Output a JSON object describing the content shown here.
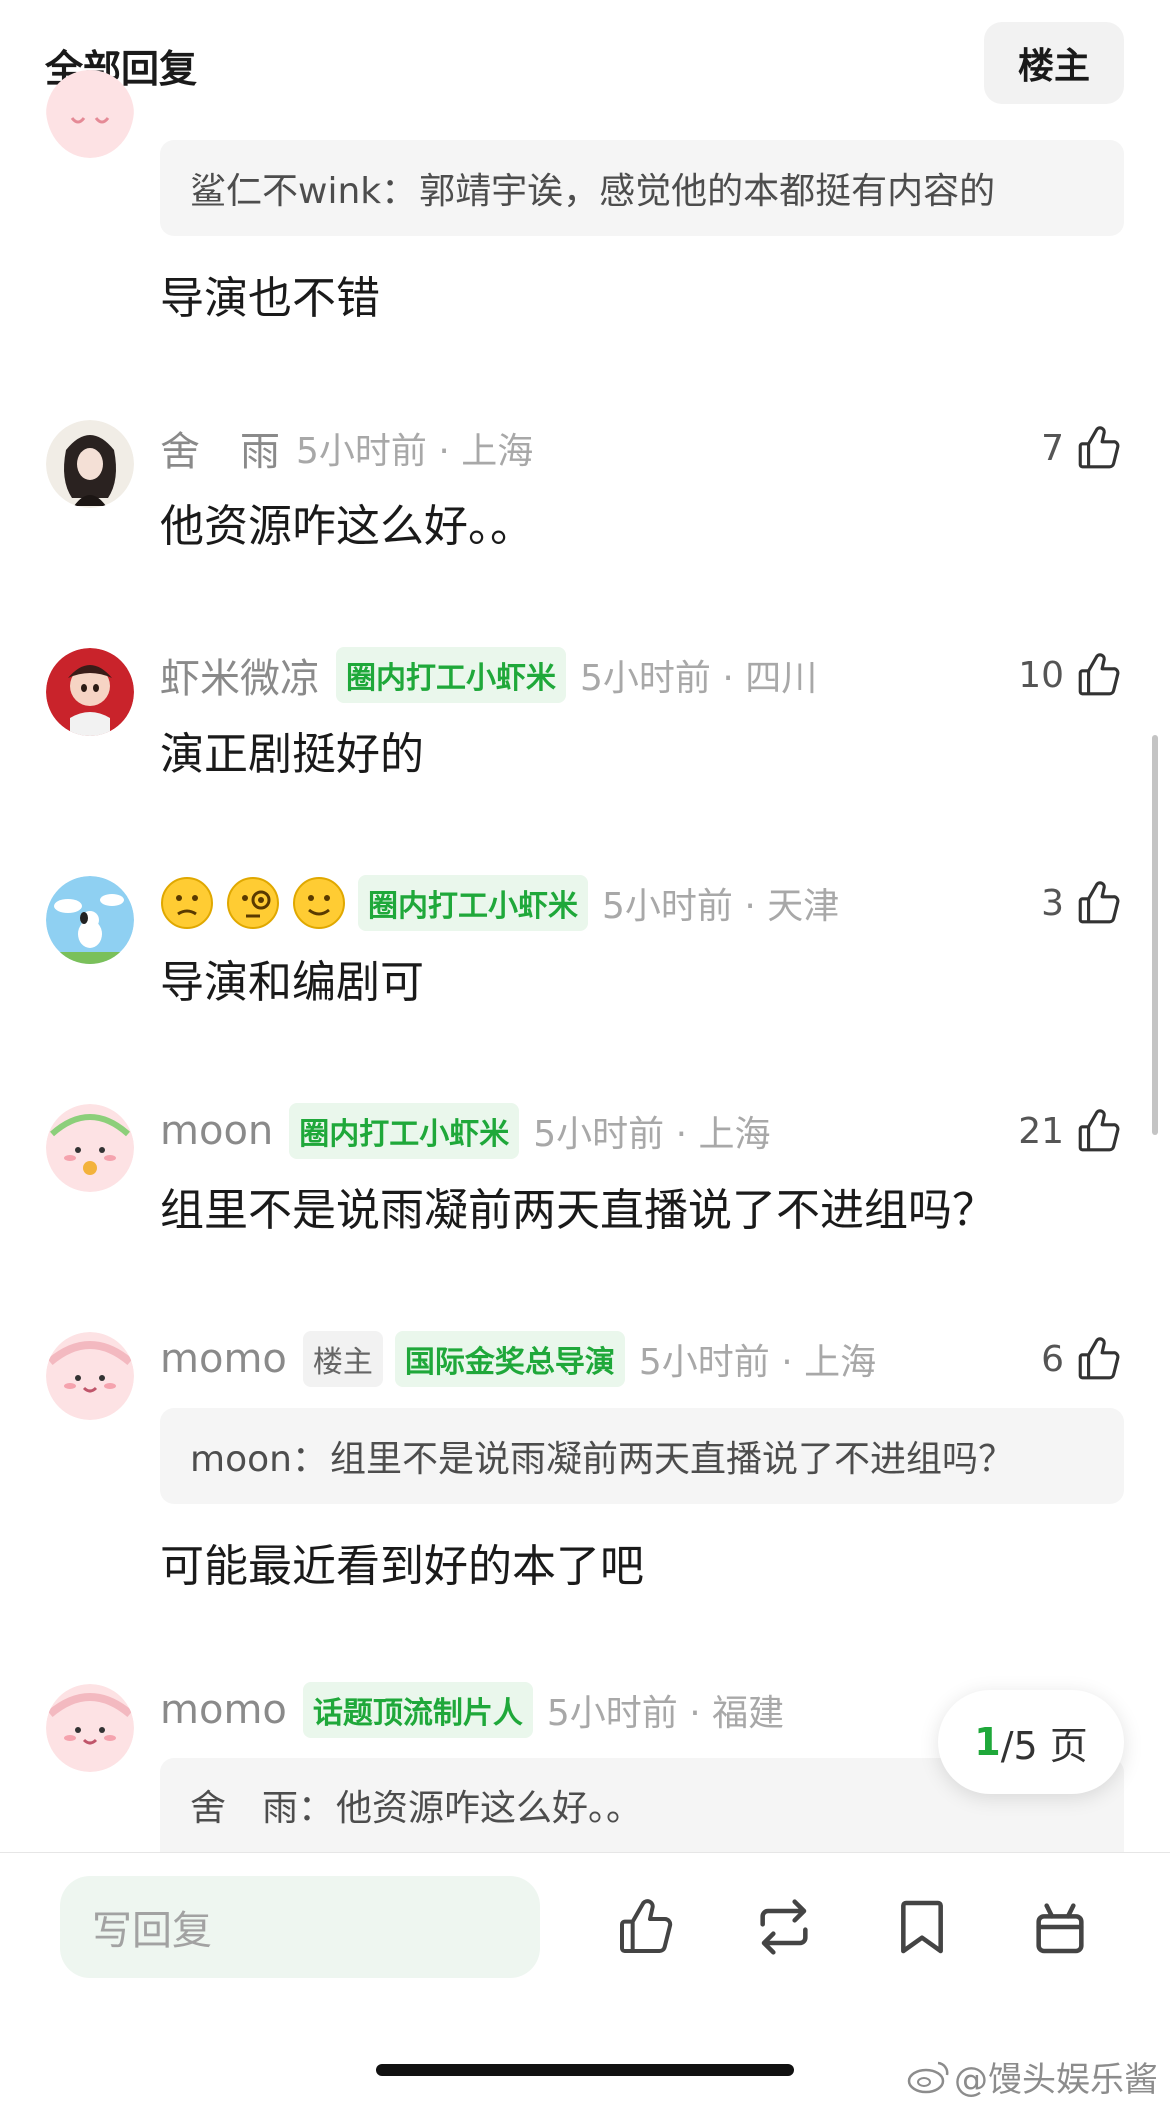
{
  "header": {
    "title": "全部回复",
    "owner_button": "楼主"
  },
  "comments": [
    {
      "quote_name": "鲨仁不wink：",
      "quote_text": "郭靖宇诶，感觉他的本都挺有内容的",
      "text": "导演也不错"
    },
    {
      "name": "舍　雨",
      "time_loc": "5小时前 · 上海",
      "likes": "7",
      "text": "他资源咋这么好。。"
    },
    {
      "name": "虾米微凉",
      "badge": "圈内打工小虾米",
      "time_loc": "5小时前 · 四川",
      "likes": "10",
      "text": "演正剧挺好的"
    },
    {
      "badge": "圈内打工小虾米",
      "time_loc": "5小时前 · 天津",
      "likes": "3",
      "text": "导演和编剧可",
      "name_emojis": [
        "confused-face",
        "monocle-face",
        "slight-smile-face"
      ]
    },
    {
      "name": "moon",
      "badge": "圈内打工小虾米",
      "time_loc": "5小时前 · 上海",
      "likes": "21",
      "text": "组里不是说雨凝前两天直播说了不进组吗？"
    },
    {
      "name": "momo",
      "owner_badge": "楼主",
      "badge": "国际金奖总导演",
      "time_loc": "5小时前 · 上海",
      "likes": "6",
      "quote_name": "moon：",
      "quote_text": "组里不是说雨凝前两天直播说了不进组吗？",
      "text": "可能最近看到好的本了吧"
    },
    {
      "name": "momo",
      "badge": "话题顶流制片人",
      "time_loc": "5小时前 · 福建",
      "quote_name": "舍　雨：",
      "quote_text": "他资源咋这么好。。"
    }
  ],
  "pagination": {
    "current": "1",
    "total": "/5 页"
  },
  "bottom_bar": {
    "reply_placeholder": "写回复",
    "icons": [
      "thumbs-up-icon",
      "repost-icon",
      "bookmark-icon",
      "gift-icon"
    ]
  },
  "watermark": "@馒头娱乐酱",
  "colors": {
    "accent_green": "#1fa83a",
    "badge_bg": "#eaf7ec",
    "quote_bg": "#f5f5f5"
  }
}
